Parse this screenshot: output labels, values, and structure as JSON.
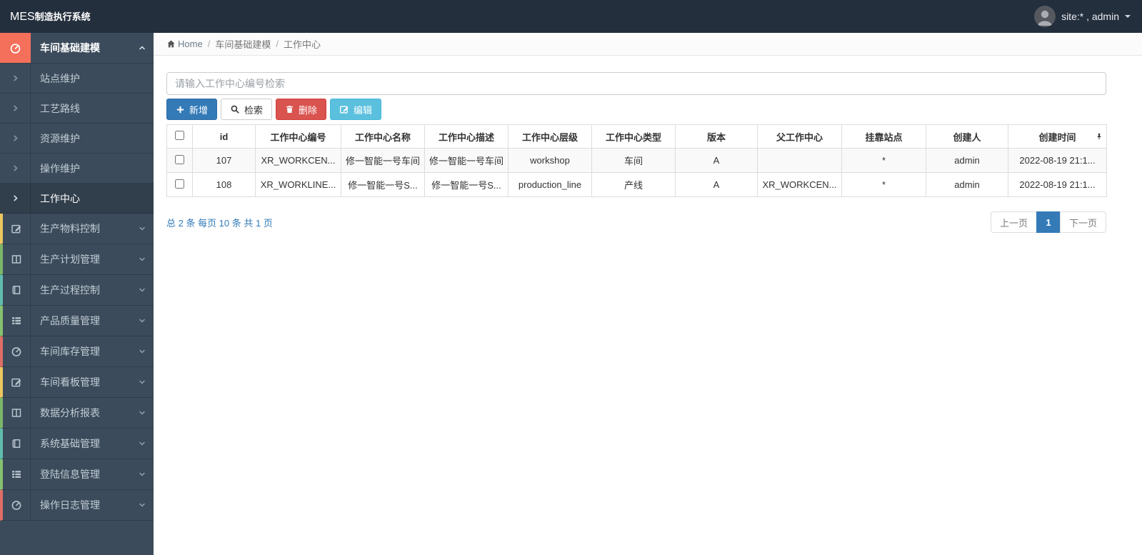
{
  "navbar": {
    "logo_bold": "MES",
    "logo_rest": "制造执行系统",
    "user_label": "site:* , admin"
  },
  "breadcrumb": {
    "home_label": "Home",
    "separator": "/",
    "items": [
      "车间基础建模",
      "工作中心"
    ]
  },
  "sidebar": {
    "group": {
      "label": "车间基础建模",
      "icon": "gauge-icon",
      "state": "expanded"
    },
    "submenu": [
      {
        "label": "站点维护",
        "active": false
      },
      {
        "label": "工艺路线",
        "active": false
      },
      {
        "label": "资源维护",
        "active": false
      },
      {
        "label": "操作维护",
        "active": false
      },
      {
        "label": "工作中心",
        "active": true
      }
    ],
    "items": [
      {
        "label": "生产物料控制",
        "icon": "edit-icon",
        "accent": "#ecc55f",
        "strip": "--strip:#ecc55f"
      },
      {
        "label": "生产计划管理",
        "icon": "columns-icon",
        "accent": "#7db46b",
        "strip": "--strip:#7db46b"
      },
      {
        "label": "生产过程控制",
        "icon": "book-icon",
        "accent": "#5fbbae",
        "strip": "--strip:#5fbbae"
      },
      {
        "label": "产品质量管理",
        "icon": "list-icon",
        "accent": "#86c16f",
        "strip": "--strip:#86c16f"
      },
      {
        "label": "车间库存管理",
        "icon": "gauge-icon",
        "accent": "#df6e67",
        "strip": "--strip:#df6e67"
      },
      {
        "label": "车间看板管理",
        "icon": "edit-icon",
        "accent": "#ecc55f",
        "strip": "--strip:#ecc55f"
      },
      {
        "label": "数据分析报表",
        "icon": "columns-icon",
        "accent": "#7db46b",
        "strip": "--strip:#7db46b"
      },
      {
        "label": "系统基础管理",
        "icon": "book-icon",
        "accent": "#5fbbae",
        "strip": "--strip:#5fbbae"
      },
      {
        "label": "登陆信息管理",
        "icon": "list-icon",
        "accent": "#86c16f",
        "strip": "--strip:#86c16f"
      },
      {
        "label": "操作日志管理",
        "icon": "gauge-icon",
        "accent": "#df6e67",
        "strip": "--strip:#df6e67"
      }
    ]
  },
  "toolbar": {
    "search_placeholder": "请输入工作中心编号检索",
    "add_label": "新增",
    "search_label": "检索",
    "delete_label": "删除",
    "edit_label": "编辑"
  },
  "table": {
    "columns": [
      "id",
      "工作中心编号",
      "工作中心名称",
      "工作中心描述",
      "工作中心层级",
      "工作中心类型",
      "版本",
      "父工作中心",
      "挂靠站点",
      "创建人",
      "创建时间"
    ],
    "rows": [
      {
        "cells": [
          "107",
          "XR_WORKCEN...",
          "修一智能一号车间",
          "修一智能一号车间",
          "workshop",
          "车间",
          "A",
          "",
          "*",
          "admin",
          "2022-08-19 21:1..."
        ]
      },
      {
        "cells": [
          "108",
          "XR_WORKLINE...",
          "修一智能一号S...",
          "修一智能一号S...",
          "production_line",
          "产线",
          "A",
          "XR_WORKCEN...",
          "*",
          "admin",
          "2022-08-19 21:1..."
        ]
      }
    ]
  },
  "pagination": {
    "summary": "总 2 条  每页 10 条  共 1 页",
    "prev_label": "上一页",
    "current_page": "1",
    "next_label": "下一页"
  },
  "colors": {
    "navbar_bg": "#242f3d",
    "sidebar_bg": "#3b4b5b",
    "active_group_icon_bg": "#f4705b",
    "primary": "#337ab7",
    "danger": "#d9534f",
    "info": "#5bc0de",
    "link_blue": "#337ab7",
    "table_border": "#dddddd",
    "striped_row": "#f9f9f9"
  }
}
